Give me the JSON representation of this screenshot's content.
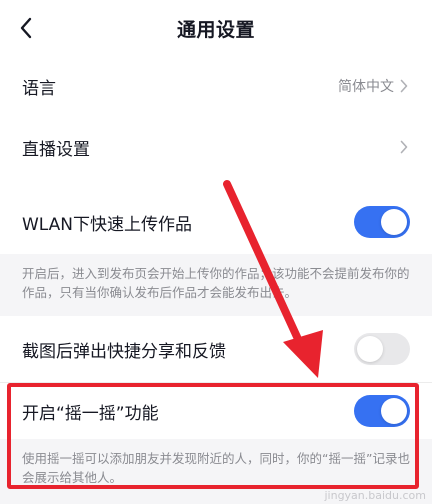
{
  "header": {
    "title": "通用设置"
  },
  "rows": {
    "language": {
      "label": "语言",
      "value": "简体中文"
    },
    "live": {
      "label": "直播设置"
    },
    "wlan": {
      "label": "WLAN下快速上传作品",
      "enabled": true,
      "description": "开启后，进入到发布页会开始上传你的作品；该功能不会提前发布你的作品，只有当你确认发布后作品才会能发布出去。"
    },
    "screenshot": {
      "label": "截图后弹出快捷分享和反馈",
      "enabled": false
    },
    "shake": {
      "label": "开启“摇一摇”功能",
      "enabled": true,
      "description": "使用摇一摇可以添加朋友并发现附近的人，同时，你的“摇一摇”记录也会展示给其他人。"
    }
  },
  "annotation": {
    "color": "#e8232e"
  },
  "colors": {
    "toggle_on": "#3671f2",
    "toggle_off": "#e8e8ea"
  },
  "watermark": "jingyan.baidu.com"
}
